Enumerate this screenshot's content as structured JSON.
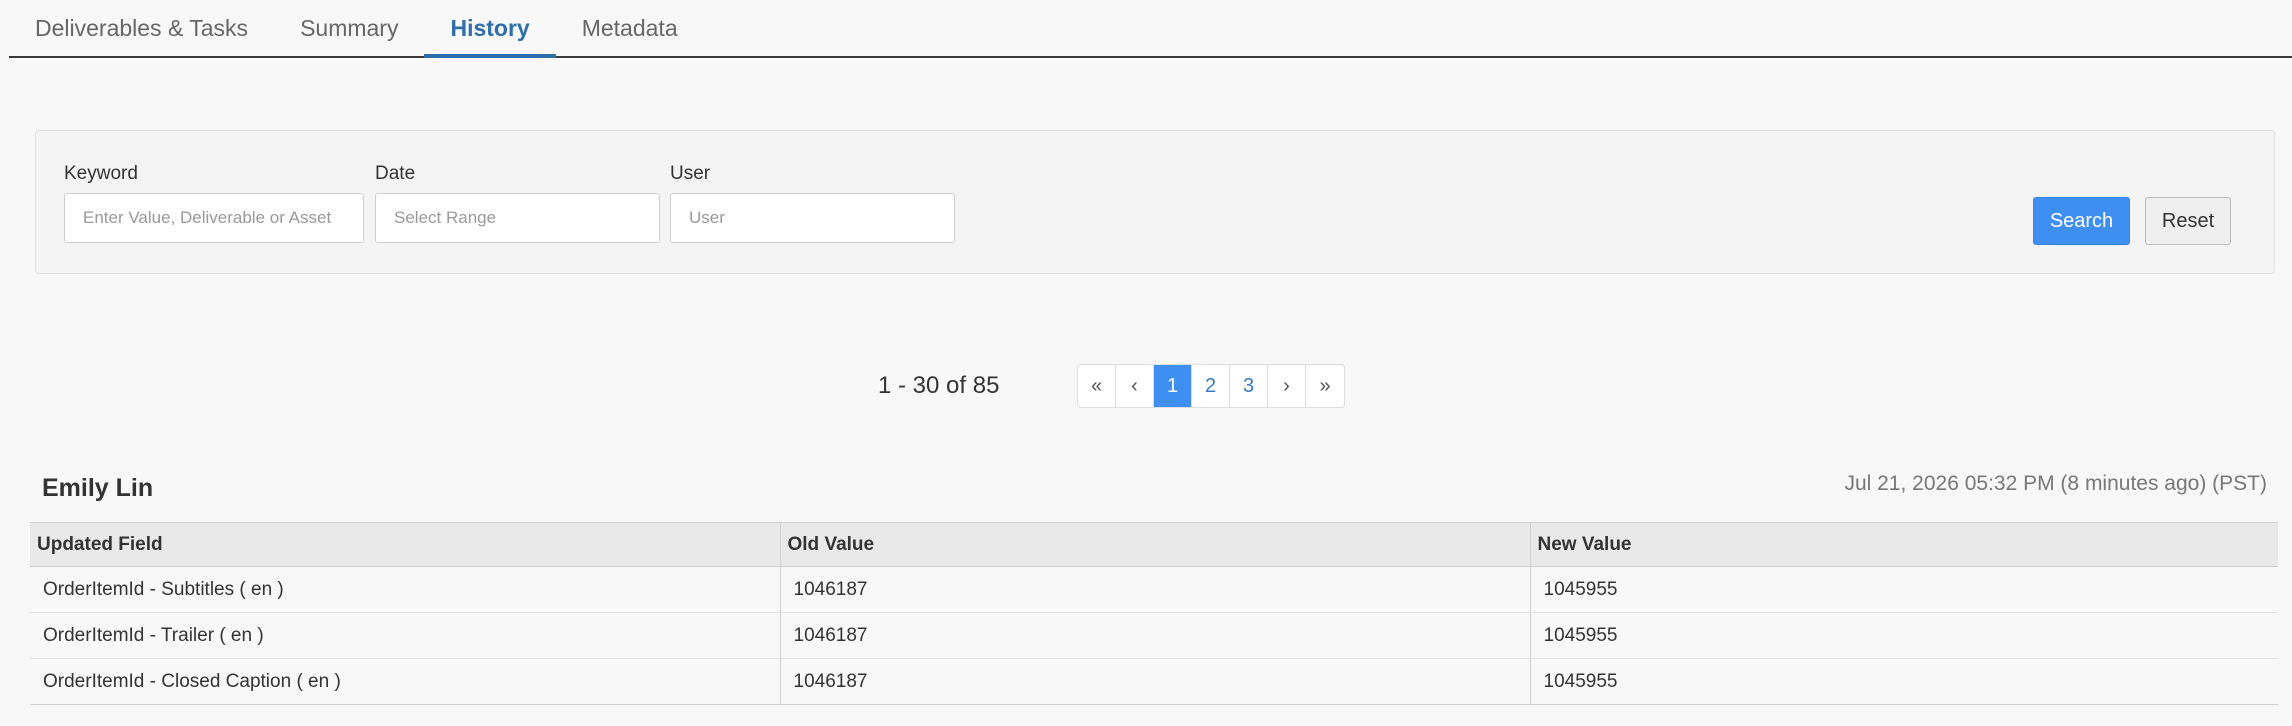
{
  "tabs": [
    {
      "label": "Deliverables & Tasks",
      "active": false
    },
    {
      "label": "Summary",
      "active": false
    },
    {
      "label": "History",
      "active": true
    },
    {
      "label": "Metadata",
      "active": false
    }
  ],
  "filters": {
    "keyword": {
      "label": "Keyword",
      "placeholder": "Enter Value, Deliverable or Asset"
    },
    "date": {
      "label": "Date",
      "placeholder": "Select Range"
    },
    "user": {
      "label": "User",
      "placeholder": "User"
    },
    "search_label": "Search",
    "reset_label": "Reset"
  },
  "pagination": {
    "range_text": "1 - 30 of 85",
    "first": "«",
    "prev": "‹",
    "pages": [
      "1",
      "2",
      "3"
    ],
    "current_page": "1",
    "next": "›",
    "last": "»"
  },
  "entry": {
    "user": "Emily Lin",
    "timestamp": "Jul 21, 2026 05:32 PM (8 minutes ago) (PST)",
    "columns": [
      "Updated Field",
      "Old Value",
      "New Value"
    ],
    "rows": [
      [
        "OrderItemId - Subtitles ( en )",
        "1046187",
        "1045955"
      ],
      [
        "OrderItemId - Trailer ( en )",
        "1046187",
        "1045955"
      ],
      [
        "OrderItemId - Closed Caption ( en )",
        "1046187",
        "1045955"
      ]
    ]
  },
  "colors": {
    "accent": "#2f6ea8",
    "primary_button": "#3f8ef2"
  }
}
